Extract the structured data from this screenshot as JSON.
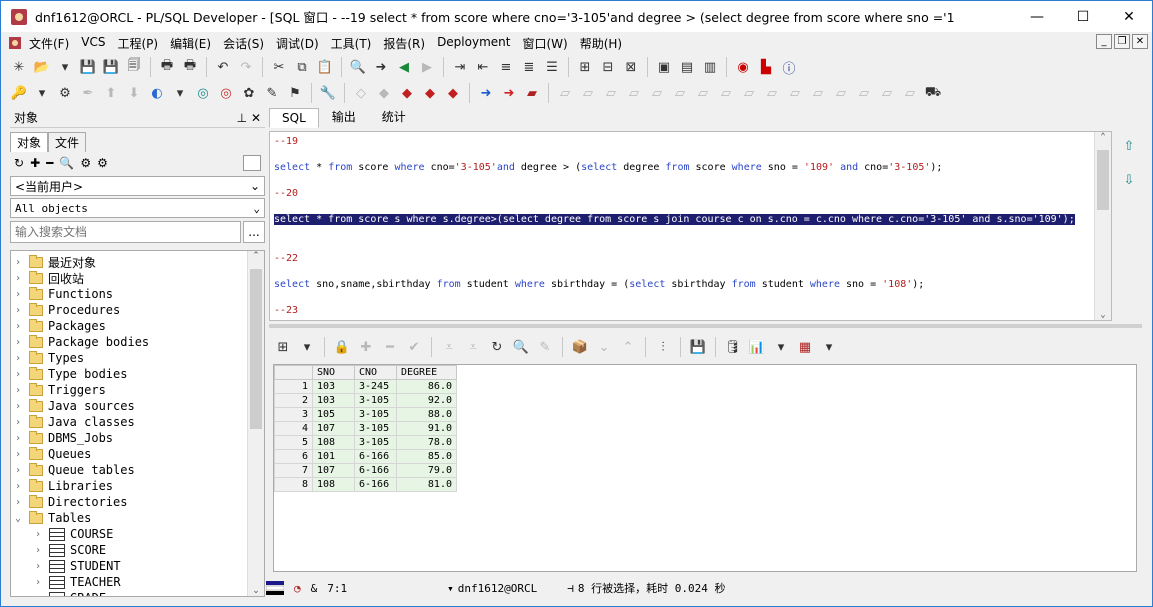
{
  "window": {
    "title": "dnf1612@ORCL - PL/SQL Developer - [SQL 窗口 - --19 select * from score where cno='3-105'and degree > (select degree from score where sno ='10 ...]",
    "minimize": "—",
    "maximize": "☐",
    "close": "✕"
  },
  "menu": {
    "items": [
      "文件(F)",
      "VCS",
      "工程(P)",
      "编辑(E)",
      "会话(S)",
      "调试(D)",
      "工具(T)",
      "报告(R)",
      "Deployment",
      "窗口(W)",
      "帮助(H)"
    ],
    "mdi_min": "_",
    "mdi_restore": "❐",
    "mdi_close": "✕"
  },
  "left_panel": {
    "header": "对象",
    "pin": "⊥ ✕",
    "tabs": [
      "对象",
      "文件"
    ],
    "user_select": "<当前用户>",
    "objects_select": "All objects",
    "search_placeholder": "输入搜索文档",
    "search_btn": "...",
    "tree": [
      {
        "label": "最近对象",
        "expanded": false
      },
      {
        "label": "回收站",
        "expanded": false
      },
      {
        "label": "Functions",
        "expanded": false
      },
      {
        "label": "Procedures",
        "expanded": false
      },
      {
        "label": "Packages",
        "expanded": false
      },
      {
        "label": "Package bodies",
        "expanded": false
      },
      {
        "label": "Types",
        "expanded": false
      },
      {
        "label": "Type bodies",
        "expanded": false
      },
      {
        "label": "Triggers",
        "expanded": false
      },
      {
        "label": "Java sources",
        "expanded": false
      },
      {
        "label": "Java classes",
        "expanded": false
      },
      {
        "label": "DBMS_Jobs",
        "expanded": false
      },
      {
        "label": "Queues",
        "expanded": false
      },
      {
        "label": "Queue tables",
        "expanded": false
      },
      {
        "label": "Libraries",
        "expanded": false
      },
      {
        "label": "Directories",
        "expanded": false
      },
      {
        "label": "Tables",
        "expanded": true
      }
    ],
    "tables": [
      "COURSE",
      "SCORE",
      "STUDENT",
      "TEACHER",
      "GRADE"
    ]
  },
  "editor": {
    "tabs": [
      "SQL",
      "输出",
      "统计"
    ],
    "lines": [
      [
        {
          "t": "--19",
          "c": "cmt"
        }
      ],
      [],
      [
        {
          "t": "select",
          "c": "kw"
        },
        {
          "t": " * "
        },
        {
          "t": "from",
          "c": "kw"
        },
        {
          "t": " score "
        },
        {
          "t": "where",
          "c": "kw"
        },
        {
          "t": " cno="
        },
        {
          "t": "'3-105'",
          "c": "str"
        },
        {
          "t": "and",
          "c": "kw"
        },
        {
          "t": " degree > ("
        },
        {
          "t": "select",
          "c": "kw"
        },
        {
          "t": " degree "
        },
        {
          "t": "from",
          "c": "kw"
        },
        {
          "t": " score "
        },
        {
          "t": "where",
          "c": "kw"
        },
        {
          "t": " sno = "
        },
        {
          "t": "'109'",
          "c": "str"
        },
        {
          "t": " "
        },
        {
          "t": "and",
          "c": "kw"
        },
        {
          "t": " cno="
        },
        {
          "t": "'3-105'",
          "c": "str"
        },
        {
          "t": ");"
        }
      ],
      [],
      [
        {
          "t": "--20",
          "c": "cmt"
        }
      ],
      [],
      [
        {
          "t": "select * from score s where s.degree>(select degree from score s join course c on s.cno = c.cno where c.cno='3-105' and s.sno='109');",
          "c": "hl"
        }
      ],
      [],
      [],
      [
        {
          "t": "--22",
          "c": "cmt"
        }
      ],
      [],
      [
        {
          "t": "select",
          "c": "kw"
        },
        {
          "t": " sno,sname,sbirthday "
        },
        {
          "t": "from",
          "c": "kw"
        },
        {
          "t": " student "
        },
        {
          "t": "where",
          "c": "kw"
        },
        {
          "t": " sbirthday = ("
        },
        {
          "t": "select",
          "c": "kw"
        },
        {
          "t": " sbirthday "
        },
        {
          "t": "from",
          "c": "kw"
        },
        {
          "t": " student "
        },
        {
          "t": "where",
          "c": "kw"
        },
        {
          "t": " sno = "
        },
        {
          "t": "'108'",
          "c": "str"
        },
        {
          "t": ");"
        }
      ],
      [],
      [
        {
          "t": "--23",
          "c": "cmt"
        }
      ]
    ]
  },
  "results": {
    "columns": [
      "SNO",
      "CNO",
      "DEGREE"
    ],
    "rows": [
      [
        "1",
        "103",
        "3-245",
        "86.0"
      ],
      [
        "2",
        "103",
        "3-105",
        "92.0"
      ],
      [
        "3",
        "105",
        "3-105",
        "88.0"
      ],
      [
        "4",
        "107",
        "3-105",
        "91.0"
      ],
      [
        "5",
        "108",
        "3-105",
        "78.0"
      ],
      [
        "6",
        "101",
        "6-166",
        "85.0"
      ],
      [
        "7",
        "107",
        "6-166",
        "79.0"
      ],
      [
        "8",
        "108",
        "6-166",
        "81.0"
      ]
    ]
  },
  "status": {
    "ampersand": "&",
    "position": "7:1",
    "connection": "dnf1612@ORCL",
    "message": "8 行被选择，耗时 0.024 秒"
  }
}
